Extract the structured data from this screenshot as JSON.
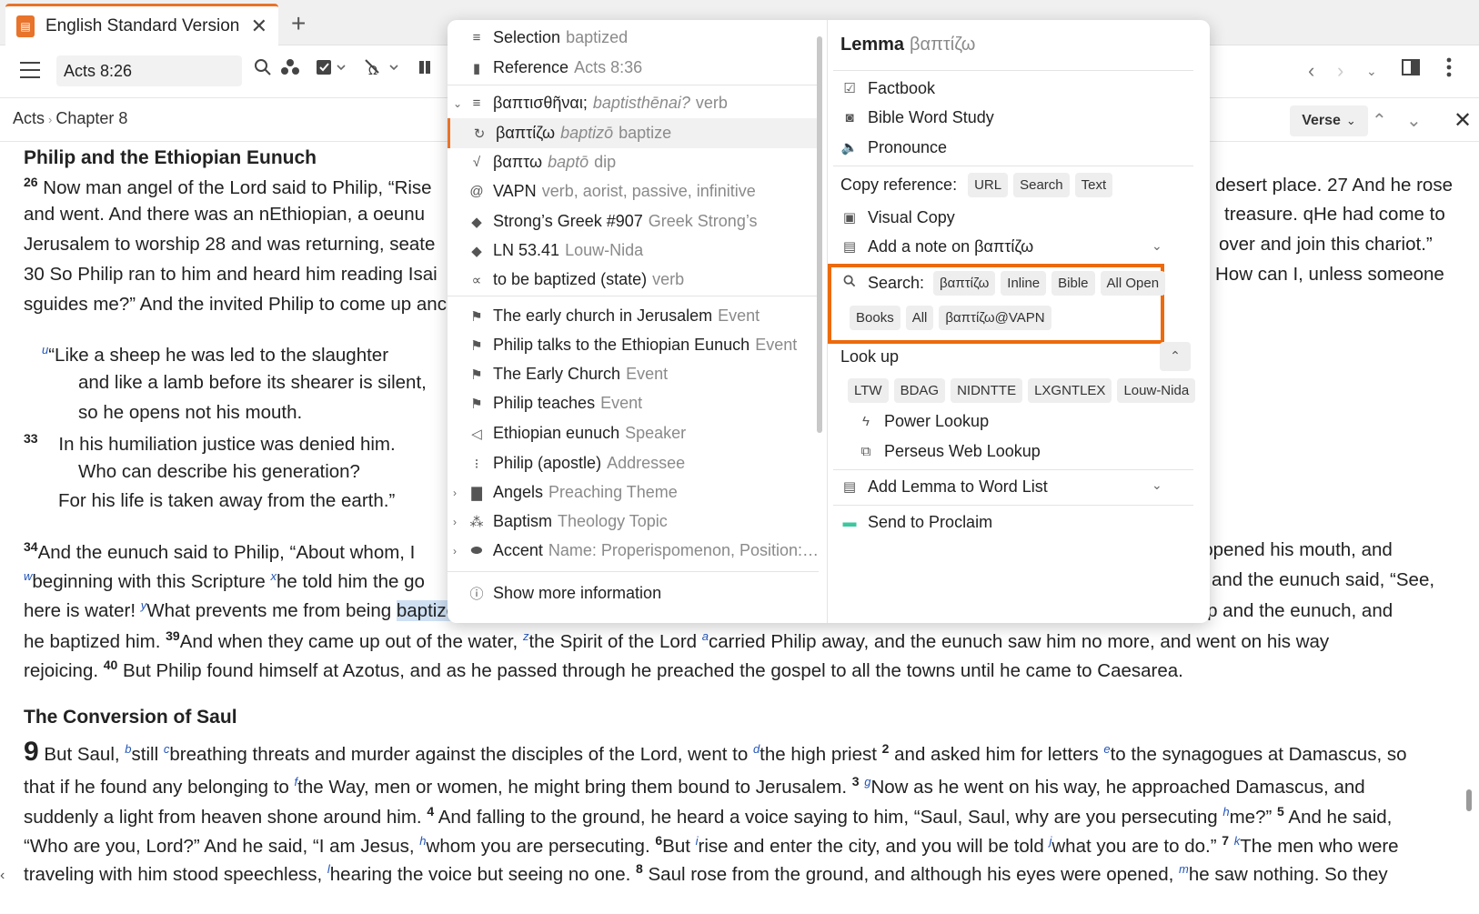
{
  "tab": {
    "title": "English Standard Version",
    "close": "✕",
    "new": "+"
  },
  "toolbar": {
    "reference": "Acts 8:26"
  },
  "breadcrumb": {
    "book": "Acts",
    "chapter": "Chapter 8"
  },
  "verse_button": "Verse",
  "bible": {
    "heading1": "Philip and the Ethiopian Eunuch",
    "heading2": "The Conversion of Saul",
    "lines": [
      "Now man angel of the Lord said to Philip, “Rise",
      "and went. And there was an nEthiopian, a oeunu",
      "Jerusalem to worship 28 and was returning, seate",
      "30 So Philip ran to him and heard him reading Isai",
      "sguides me?” And the invited Philip to come up anc"
    ],
    "right_fragments": [
      "desert place. 27 And he rose",
      "treasure. qHe had come to",
      "over and join this chariot.”",
      "How can I, unless someone"
    ],
    "poem": [
      "“Like a sheep he was led to the slaughter",
      "and like a lamb before its shearer is silent,",
      "so he opens not his mouth.",
      "In his humiliation justice was denied him.",
      "Who can describe his generation?",
      "For his life is taken away from the earth.”"
    ],
    "verse34_left": "And the eunuch said to Philip, “About whom, I",
    "verse34_right": "lip opened his mouth, and",
    "verse35_left": "beginning with this Scripture",
    "verse35_mid": "he told him the go",
    "verse35_right": "and the eunuch said, “See,",
    "verse36_a": "here is water!",
    "verse36_b": "What prevents me from being",
    "verse36_highlight": "baptized",
    "verse36_c": "? 38 And he commanded the chariot to stop, and they both went down into the water, Philip and the eunuch, and",
    "verse38_line": "he baptized him.",
    "verse39": "And when they came up out of the water,",
    "verse39_b": "the Spirit of the Lord",
    "verse39_c": "carried Philip away, and the eunuch saw him no more, and went on his way",
    "verse40_a": "rejoicing.",
    "verse40_b": "But Philip found himself at Azotus, and as he passed through he preached the gospel to all the towns until he came to Caesarea.",
    "ch9_l1_a": "But Saul,",
    "ch9_l1_b": "still",
    "ch9_l1_c": "breathing threats and murder against the disciples of the Lord, went to",
    "ch9_l1_d": "the high priest",
    "ch9_l1_e": "and asked him for letters",
    "ch9_l1_f": "to the synagogues at Damascus, so",
    "ch9_l2_a": "that if he found any belonging to",
    "ch9_l2_b": "the Way, men or women, he might bring them bound to Jerusalem.",
    "ch9_l2_c": "Now as he went on his way, he approached Damascus, and",
    "ch9_l3_a": "suddenly a light from heaven shone around him.",
    "ch9_l3_b": "And falling to the ground, he heard a voice saying to him, “Saul, Saul, why are you persecuting",
    "ch9_l3_c": "me?”",
    "ch9_l3_d": "And he said,",
    "ch9_l4_a": "“Who are you, Lord?” And he said, “I am Jesus,",
    "ch9_l4_b": "whom you are persecuting.",
    "ch9_l4_c": "But",
    "ch9_l4_d": "rise and enter the city, and you will be told",
    "ch9_l4_e": "what you are to do.”",
    "ch9_l4_f": "The men who were",
    "ch9_l5_a": "traveling with him stood speechless,",
    "ch9_l5_b": "hearing the voice but seeing no one.",
    "ch9_l5_c": "Saul rose from the ground, and although his eyes were opened,",
    "ch9_l5_d": "he saw nothing. So they"
  },
  "menu_left": [
    {
      "label": "Selection",
      "muted": "baptized",
      "icon": "≡"
    },
    {
      "label": "Reference",
      "muted": "Acts 8:36",
      "icon": "▮"
    },
    {
      "label": "βαπτισθῆναι;",
      "muted_italic": "baptisthēnai?",
      "muted": "verb",
      "icon": "≡"
    },
    {
      "label": "βαπτίζω",
      "muted_italic": "baptizō",
      "muted": "baptize",
      "icon": "↻"
    },
    {
      "label": "βαπτω",
      "muted_italic": "baptō",
      "muted": "dip",
      "icon": "√"
    },
    {
      "label": "VAPN",
      "muted": "verb, aorist, passive, infinitive",
      "icon": "@"
    },
    {
      "label": "Strong’s Greek #907",
      "muted": "Greek Strong’s",
      "icon": "◆"
    },
    {
      "label": "LN 53.41",
      "muted": "Louw-Nida",
      "icon": "◆"
    },
    {
      "label": "to be baptized (state)",
      "muted": "verb",
      "icon": "∝"
    },
    {
      "label": "The early church in Jerusalem",
      "muted": "Event",
      "icon": "⚑"
    },
    {
      "label": "Philip talks to the Ethiopian Eunuch",
      "muted": "Event",
      "icon": "⚑"
    },
    {
      "label": "The Early Church",
      "muted": "Event",
      "icon": "⚑"
    },
    {
      "label": "Philip teaches",
      "muted": "Event",
      "icon": "⚑"
    },
    {
      "label": "Ethiopian eunuch",
      "muted": "Speaker",
      "icon": "◁"
    },
    {
      "label": "Philip (apostle)",
      "muted": "Addressee",
      "icon": "⁝"
    },
    {
      "label": "Angels",
      "muted": "Preaching Theme",
      "icon": "▇"
    },
    {
      "label": "Baptism",
      "muted": "Theology Topic",
      "icon": "⁂"
    },
    {
      "label": "Accent",
      "muted": "Name: Properispomenon, Position:…",
      "icon": "⬬"
    },
    {
      "label": "Show more information",
      "icon": "ⓘ"
    }
  ],
  "menu_right": {
    "lemma_label": "Lemma",
    "lemma_word": "βαπτίζω",
    "factbook": "Factbook",
    "bible_word_study": "Bible Word Study",
    "pronounce": "Pronounce",
    "copy_reference": "Copy reference:",
    "copy_chips": [
      "URL",
      "Search",
      "Text"
    ],
    "visual_copy": "Visual Copy",
    "add_note": "Add a note on βαπτίζω",
    "search_label": "Search:",
    "search_chips_1": [
      "βαπτίζω",
      "Inline",
      "Bible",
      "All Open"
    ],
    "search_chips_2": [
      "Books",
      "All",
      "βαπτίζω@VAPN"
    ],
    "look_up": "Look up",
    "lookup_chips": [
      "LTW",
      "BDAG",
      "NIDNTTE",
      "LXGNTLEX",
      "Louw-Nida"
    ],
    "power_lookup": "Power Lookup",
    "perseus": "Perseus Web Lookup",
    "add_lemma": "Add Lemma to Word List",
    "send_proclaim": "Send to Proclaim"
  },
  "colors": {
    "accent": "#e8732a",
    "highlight_box": "#ec6a0c",
    "footnote": "#2255bb",
    "selection": "#cfe0f3"
  }
}
